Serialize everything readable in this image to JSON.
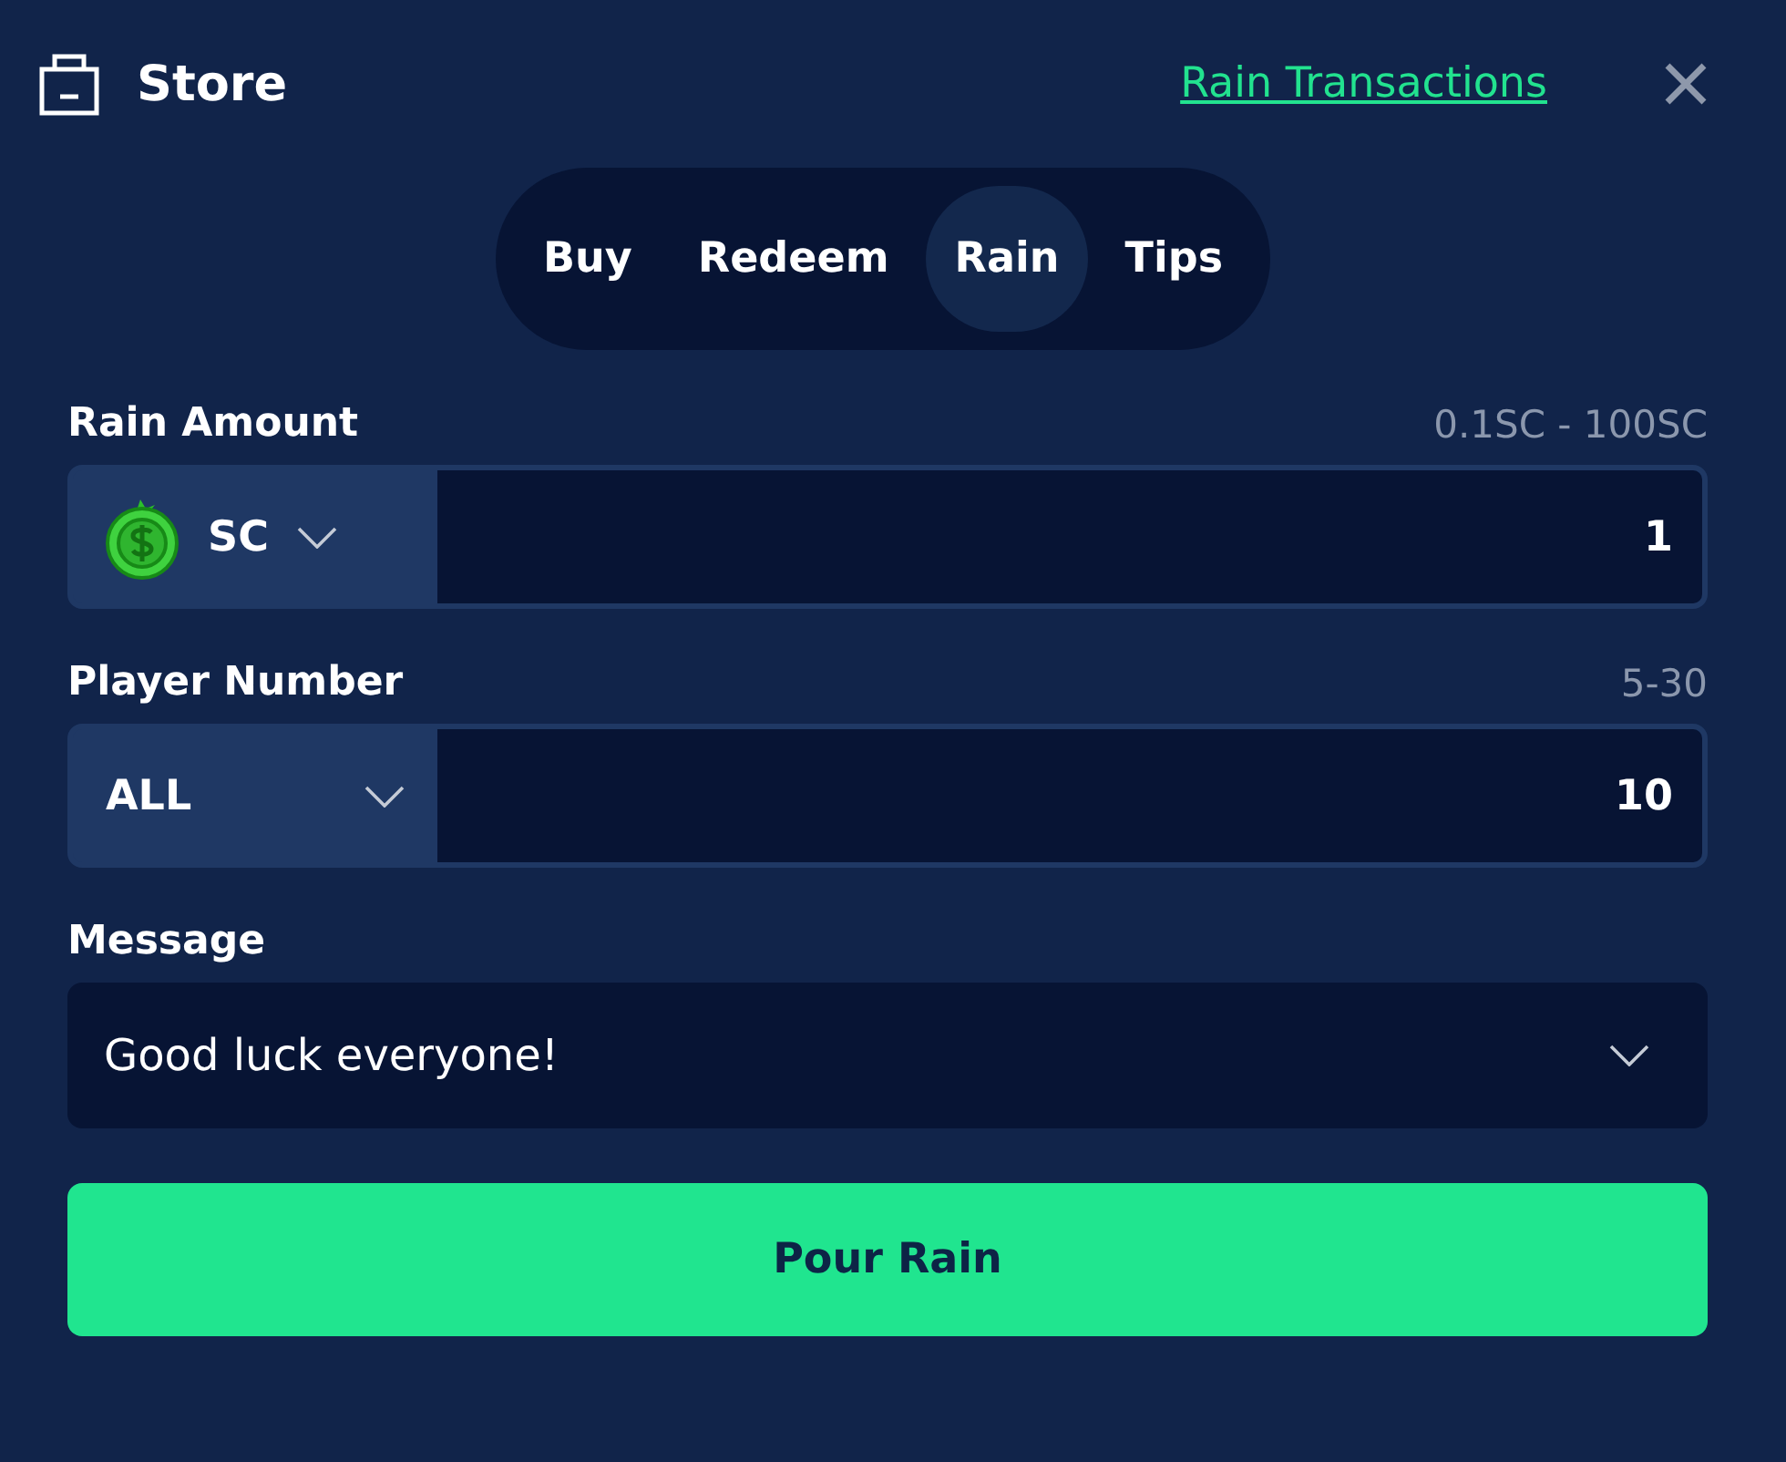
{
  "header": {
    "title": "Store",
    "link": "Rain Transactions"
  },
  "tabs": [
    {
      "label": "Buy",
      "selected": false
    },
    {
      "label": "Redeem",
      "selected": false
    },
    {
      "label": "Rain",
      "selected": true
    },
    {
      "label": "Tips",
      "selected": false
    }
  ],
  "rain_amount": {
    "label": "Rain Amount",
    "range": "0.1SC - 100SC",
    "currency": "SC",
    "value": "1"
  },
  "player_number": {
    "label": "Player Number",
    "range": "5-30",
    "option": "ALL",
    "value": "10"
  },
  "message": {
    "label": "Message",
    "value": "Good luck everyone!"
  },
  "submit": "Pour Rain"
}
